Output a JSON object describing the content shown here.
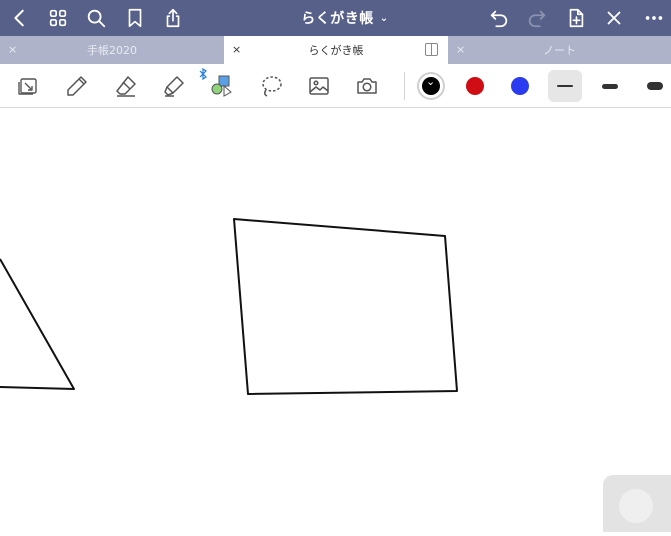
{
  "app": {
    "title": "らくがき帳",
    "title_chevron": "⌄"
  },
  "topbar": {
    "icons": [
      "back-icon",
      "grid-icon",
      "search-icon",
      "bookmark-icon",
      "share-icon"
    ],
    "right_icons": [
      "undo-icon",
      "redo-icon",
      "add-page-icon",
      "close-icon",
      "more-icon"
    ]
  },
  "tabs": [
    {
      "label": "手帳2020",
      "close": "×",
      "active": false
    },
    {
      "label": "らくがき帳",
      "close": "×",
      "active": true
    },
    {
      "label": "ノート",
      "close": "×",
      "active": false
    }
  ],
  "toolbar": {
    "tools": [
      "read-mode-icon",
      "pen-icon",
      "eraser-icon",
      "highlighter-icon",
      "shapes-icon",
      "lasso-icon",
      "image-icon",
      "camera-icon"
    ],
    "colors": [
      "#000000",
      "#d00d14",
      "#2b3cf0"
    ],
    "selected_color": "#000000",
    "stroke_widths": [
      "thin",
      "medium",
      "thick"
    ],
    "selected_width": "thin"
  },
  "colors": {
    "topbar_bg": "#566089",
    "tabbar_bg": "#aeb3c9",
    "stroke": "#111111"
  }
}
